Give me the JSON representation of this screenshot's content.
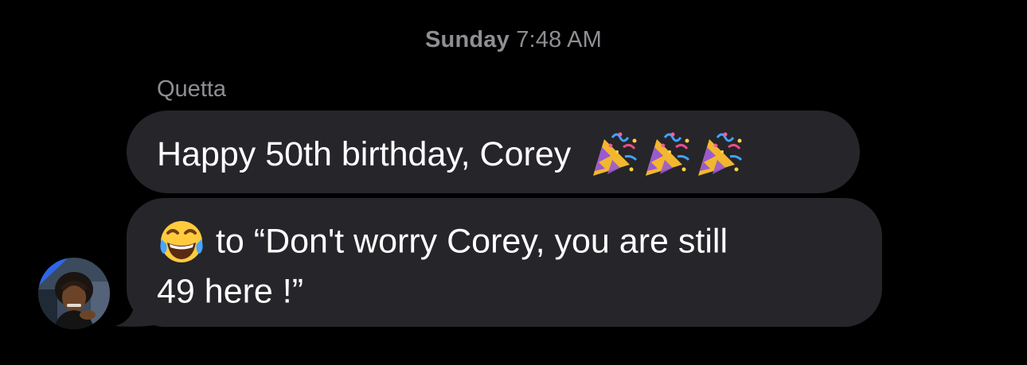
{
  "thread": {
    "timestamp_day": "Sunday",
    "timestamp_time": "7:48 AM"
  },
  "messages": [
    {
      "sender": "Quetta",
      "text": "Happy 50th birthday, Corey",
      "trailing_emoji": [
        "party-popper",
        "party-popper",
        "party-popper"
      ]
    },
    {
      "leading_emoji": "face-with-tears-of-joy",
      "text_line_1": " to “Don't worry Corey, you are still",
      "text_line_2": "49 here !”"
    }
  ],
  "colors": {
    "background": "#000000",
    "incoming_bubble": "#26252a",
    "secondary_text": "#8e8e93"
  }
}
